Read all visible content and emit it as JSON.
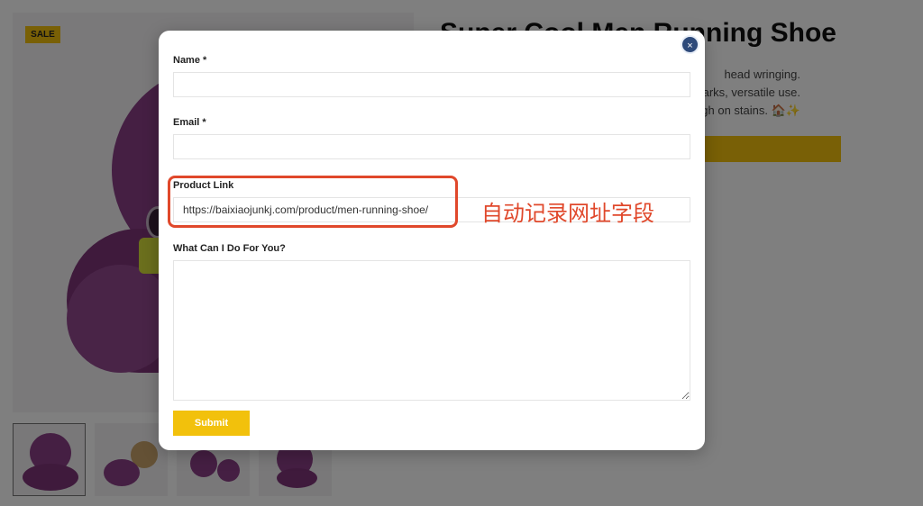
{
  "background": {
    "sale_badge": "SALE",
    "product_title": "Super Cool Men Running Shoe",
    "description_lines": [
      "head wringing.",
      "harks, versatile use.",
      "ugh on stains. 🏠✨"
    ],
    "thumbnails": [
      "thumbnail-1",
      "thumbnail-2",
      "thumbnail-3",
      "thumbnail-4"
    ]
  },
  "modal": {
    "close_label": "×",
    "fields": {
      "name_label": "Name *",
      "name_value": "",
      "email_label": "Email *",
      "email_value": "",
      "product_link_label": "Product Link",
      "product_link_value": "https://baixiaojunkj.com/product/men-running-shoe/",
      "message_label": "What Can I Do For You?",
      "message_value": ""
    },
    "submit_label": "Submit"
  },
  "annotation": {
    "text": "自动记录网址字段",
    "color": "#e0482b"
  },
  "colors": {
    "accent_yellow": "#f2c10c",
    "close_button": "#2e4a7a",
    "overlay": "rgba(0,0,0,0.5)"
  }
}
